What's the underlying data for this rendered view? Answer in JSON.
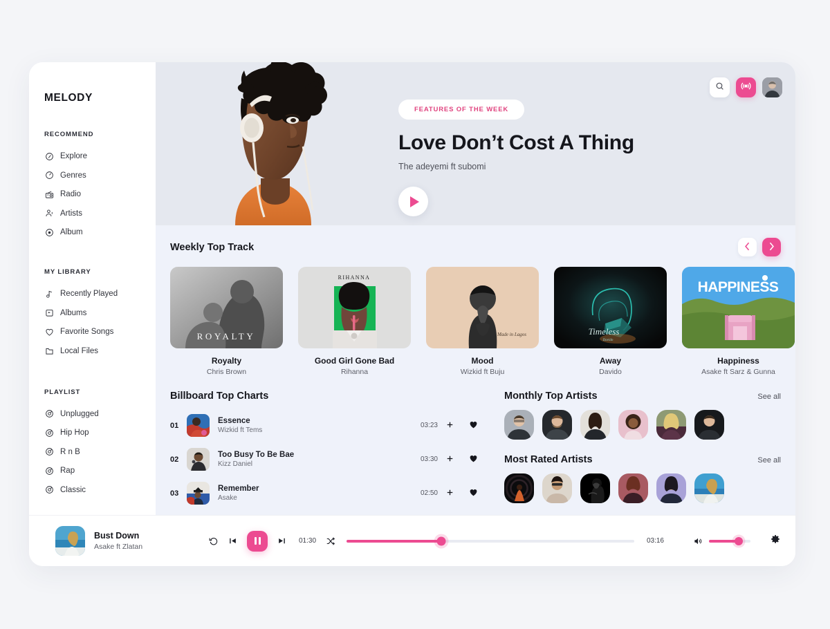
{
  "brand": "MELODY",
  "colors": {
    "accent": "#ec4b91",
    "hero_bg": "#e5e8ef",
    "content_bg": "#eff2fa",
    "page_bg": "#f4f5f8"
  },
  "sidebar": {
    "groups": [
      {
        "title": "RECOMMEND",
        "items": [
          {
            "label": "Explore",
            "icon": "compass-icon"
          },
          {
            "label": "Genres",
            "icon": "genres-icon"
          },
          {
            "label": "Radio",
            "icon": "radio-icon"
          },
          {
            "label": "Artists",
            "icon": "artists-icon"
          },
          {
            "label": "Album",
            "icon": "album-icon"
          }
        ]
      },
      {
        "title": "MY LIBRARY",
        "items": [
          {
            "label": "Recently Played",
            "icon": "music-note-icon"
          },
          {
            "label": "Albums",
            "icon": "albums-icon"
          },
          {
            "label": "Favorite Songs",
            "icon": "heart-icon"
          },
          {
            "label": "Local Files",
            "icon": "folder-icon"
          }
        ]
      },
      {
        "title": "PLAYLIST",
        "items": [
          {
            "label": "Unplugged",
            "icon": "disc-icon"
          },
          {
            "label": "Hip Hop",
            "icon": "disc-icon"
          },
          {
            "label": "R n B",
            "icon": "disc-icon"
          },
          {
            "label": "Rap",
            "icon": "disc-icon"
          },
          {
            "label": "Classic",
            "icon": "disc-icon"
          }
        ]
      }
    ]
  },
  "hero": {
    "badge": "FEATURES OF THE WEEK",
    "title": "Love Don’t Cost A Thing",
    "artist": "The adeyemi ft subomi",
    "play_icon": "play-icon",
    "actions": [
      {
        "name": "search-icon"
      },
      {
        "name": "live-broadcast-icon"
      },
      {
        "name": "user-avatar"
      }
    ]
  },
  "weekly": {
    "title": "Weekly Top Track",
    "prev_icon": "chevron-left-icon",
    "next_icon": "chevron-right-icon",
    "tracks": [
      {
        "name": "Royalty",
        "artist": "Chris Brown",
        "cover_label": "R O Y A L T Y"
      },
      {
        "name": "Good Girl Gone Bad",
        "artist": "Rihanna",
        "cover_label": "RIHANNA"
      },
      {
        "name": "Mood",
        "artist": "Wizkid ft Buju",
        "cover_label": ""
      },
      {
        "name": "Away",
        "artist": "Davido",
        "cover_label": "Timeless"
      },
      {
        "name": "Happiness",
        "artist": "Asake ft Sarz & Gunna",
        "cover_label": "HAPPINESS"
      }
    ]
  },
  "billboard": {
    "title": "Billboard Top Charts",
    "rows": [
      {
        "rank": "01",
        "title": "Essence",
        "artist": "Wizkid ft Tems",
        "time": "03:23",
        "add_icon": "plus-icon",
        "fav_icon": "heart-filled-icon"
      },
      {
        "rank": "02",
        "title": "Too Busy To Be Bae",
        "artist": "Kizz Daniel",
        "time": "03:30",
        "add_icon": "plus-icon",
        "fav_icon": "heart-filled-icon"
      },
      {
        "rank": "03",
        "title": "Remember",
        "artist": "Asake",
        "time": "02:50",
        "add_icon": "plus-icon",
        "fav_icon": "heart-filled-icon"
      }
    ]
  },
  "monthly_artists": {
    "title": "Monthly Top Artists",
    "see_all": "See all",
    "count": 6
  },
  "rated_artists": {
    "title": "Most Rated Artists",
    "see_all": "See all",
    "count": 6
  },
  "player": {
    "track_title": "Bust Down",
    "track_artist": "Asake ft Zlatan",
    "current_time": "01:30",
    "total_time": "03:16",
    "progress_percent": 33,
    "volume_percent": 72,
    "replay_icon": "replay-icon",
    "prev_icon": "skip-previous-icon",
    "pause_icon": "pause-icon",
    "next_icon": "skip-next-icon",
    "shuffle_icon": "shuffle-icon",
    "volume_icon": "volume-icon",
    "settings_icon": "gear-icon"
  }
}
